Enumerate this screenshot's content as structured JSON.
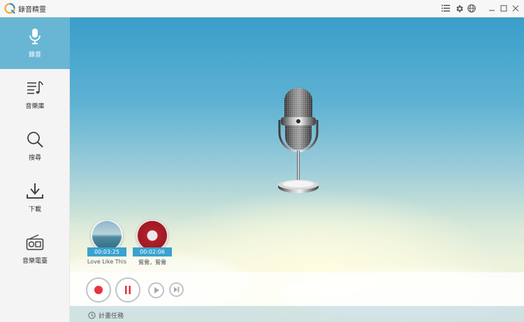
{
  "app": {
    "title": "錄音精靈"
  },
  "titlebar": {
    "icons": [
      "list-icon",
      "gear-icon",
      "globe-icon",
      "minimize-icon",
      "maximize-icon",
      "close-icon"
    ]
  },
  "sidebar": {
    "items": [
      {
        "label": "錄音",
        "icon": "microphone-icon",
        "active": true
      },
      {
        "label": "音樂庫",
        "icon": "music-list-icon",
        "active": false
      },
      {
        "label": "搜尋",
        "icon": "search-icon",
        "active": false
      },
      {
        "label": "下載",
        "icon": "download-icon",
        "active": false
      },
      {
        "label": "音樂電臺",
        "icon": "radio-icon",
        "active": false
      }
    ]
  },
  "recordings": [
    {
      "time": "00:03:25",
      "name": "Love Like This"
    },
    {
      "time": "00:02:06",
      "name": "鴛鴦，鴛鴦"
    }
  ],
  "player": {
    "buttons": [
      "record-button",
      "pause-button",
      "play-button",
      "next-button"
    ]
  },
  "status": {
    "schedule_label": "計畫任務"
  },
  "colors": {
    "accent": "#68b6d3",
    "record": "#e8343a",
    "time_badge": "#3aa2cf"
  }
}
